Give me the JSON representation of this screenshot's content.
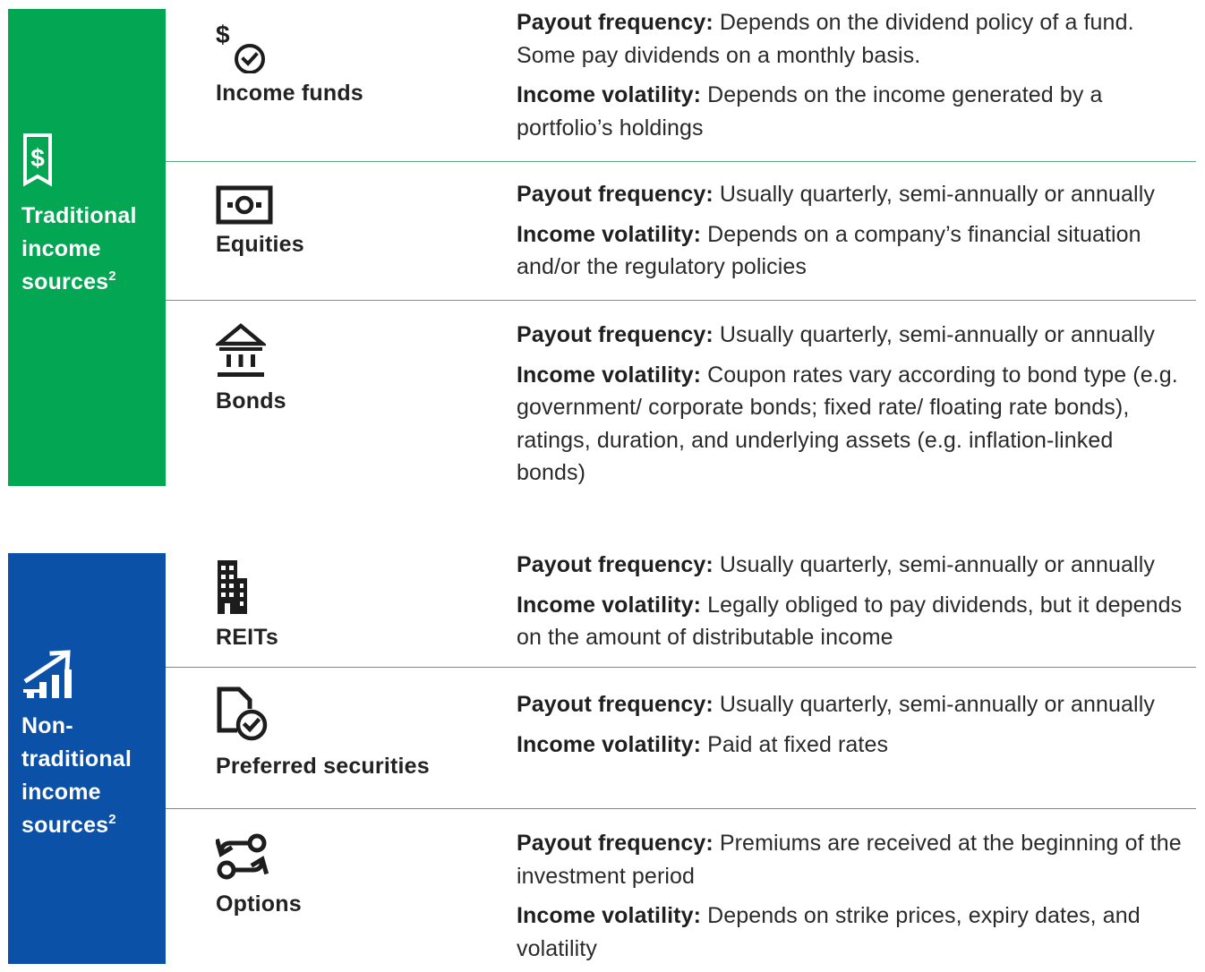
{
  "sections": [
    {
      "title_lines": [
        "Traditional",
        "income",
        "sources"
      ],
      "title_sup": "2",
      "icon": "dollar-receipt-icon",
      "color": "#02a653",
      "items": [
        {
          "name": "Income funds",
          "icon": "dollar-clock-icon",
          "payout_label": "Payout frequency:",
          "payout_text": "Depends on the dividend policy of a fund. Some pay dividends on a monthly basis.",
          "volatility_label": "Income volatility:",
          "volatility_text": "Depends on the income generated by a portfolio’s holdings"
        },
        {
          "name": "Equities",
          "icon": "banknote-icon",
          "payout_label": "Payout frequency:",
          "payout_text": "Usually quarterly, semi-annually or annually",
          "volatility_label": "Income volatility:",
          "volatility_text": "Depends on a company’s financial situation and/or the regulatory policies"
        },
        {
          "name": "Bonds",
          "icon": "bank-building-icon",
          "payout_label": "Payout frequency:",
          "payout_text": "Usually quarterly, semi-annually or annually",
          "volatility_label": "Income volatility:",
          "volatility_text": "Coupon rates vary according to bond type (e.g. government/ corporate bonds; fixed rate/ floating rate bonds), ratings, duration, and underlying assets (e.g. inflation-linked bonds)"
        }
      ]
    },
    {
      "title_lines": [
        "Non-",
        "traditional",
        "income",
        "sources"
      ],
      "title_sup": "2",
      "icon": "growth-chart-icon",
      "color": "#0b51a8",
      "items": [
        {
          "name": "REITs",
          "icon": "office-building-icon",
          "payout_label": "Payout frequency:",
          "payout_text": "Usually quarterly, semi-annually or annually",
          "volatility_label": "Income volatility:",
          "volatility_text": "Legally obliged to pay dividends, but it depends on the amount of distributable income"
        },
        {
          "name": "Preferred securities",
          "icon": "document-check-icon",
          "payout_label": "Payout frequency:",
          "payout_text": "Usually quarterly, semi-annually or annually",
          "volatility_label": "Income volatility:",
          "volatility_text": "Paid at fixed rates"
        },
        {
          "name": "Options",
          "icon": "exchange-arrows-icon",
          "payout_label": "Payout frequency:",
          "payout_text": "Premiums are received at the beginning of the investment period",
          "volatility_label": "Income volatility:",
          "volatility_text": "Depends on strike prices, expiry dates, and volatility"
        }
      ]
    }
  ]
}
